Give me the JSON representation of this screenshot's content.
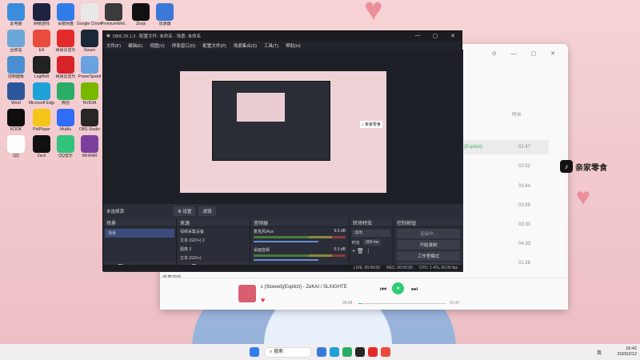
{
  "desktop": {
    "icons": [
      {
        "label": "此电脑",
        "color": "#3a8dde"
      },
      {
        "label": "网络游戏",
        "color": "#1b2340"
      },
      {
        "label": "百度网盘",
        "color": "#2f7dea"
      },
      {
        "label": "Google Chrome",
        "color": "#e8e8e8"
      },
      {
        "label": "PremiumWell...",
        "color": "#3b3b3b"
      },
      {
        "label": "Zbojs",
        "color": "#111111"
      },
      {
        "label": "加速器",
        "color": "#3b78d8"
      },
      {
        "label": "回收站",
        "color": "#6aa7d6"
      },
      {
        "label": "EA",
        "color": "#e94b3c"
      },
      {
        "label": "网易云音乐",
        "color": "#e32b2b"
      },
      {
        "label": "Steam",
        "color": "#1b2838"
      },
      {
        "label": "控制面板",
        "color": "#4a8fd1"
      },
      {
        "label": "LogiBolt",
        "color": "#222222"
      },
      {
        "label": "网易云音乐",
        "color": "#d8232a"
      },
      {
        "label": "PowerSpeed",
        "color": "#6aa1e0"
      },
      {
        "label": "Word",
        "color": "#2b579a"
      },
      {
        "label": "Microsoft Edge",
        "color": "#1fa2d8"
      },
      {
        "label": "微信",
        "color": "#2aae67"
      },
      {
        "label": "NVIDIA",
        "color": "#76b900"
      },
      {
        "label": "KOOK",
        "color": "#0d0d0d"
      },
      {
        "label": "PotPlayer",
        "color": "#f5c518"
      },
      {
        "label": "MuMu",
        "color": "#2f6df6"
      },
      {
        "label": "OBS Studio",
        "color": "#262626"
      },
      {
        "label": "QQ",
        "color": "#ffffff"
      },
      {
        "label": "Zeck",
        "color": "#111111"
      },
      {
        "label": "QQ音乐",
        "color": "#31c27c"
      },
      {
        "label": "WinRAR",
        "color": "#7b3f9e"
      }
    ],
    "wallpaper_text": ""
  },
  "music_app": {
    "right_labels": [
      "时长"
    ],
    "durations": [
      "01:47",
      "03:52",
      "03:44",
      "03:59",
      "03:30",
      "04:33",
      "01:28"
    ],
    "highlight_title": "(Explicit)",
    "bottom_label": "我喜欢听",
    "player": {
      "song": "ε (Slowed)(Explicit) - ZeKAI / SLXIGHTE",
      "elapsed": "00:04",
      "total": "01:47"
    },
    "watermark": "亲家零食"
  },
  "obs": {
    "title": "OBS 29.1.3 - 配置文件: 未命名 - 场景: 未命名",
    "menu": [
      "文件(F)",
      "编辑(E)",
      "视图(V)",
      "停靠窗口(D)",
      "配置文件(P)",
      "场景集合(S)",
      "工具(T)",
      "帮助(H)"
    ],
    "no_source": "未选择源",
    "props_btn": "⚙ 设置",
    "filter_btn": "滤镜",
    "docks": {
      "scenes": {
        "title": "场景",
        "items": [
          "场景"
        ]
      },
      "sources": {
        "title": "来源",
        "items": [
          "视频采集设备",
          "文本 (GDI+) 2",
          "图像 3",
          "文本 (GDI+)",
          "浏览器"
        ]
      },
      "mixer": {
        "title": "音频器",
        "channels": [
          {
            "name": "麦克风/Aux",
            "db": "9.5 dB"
          },
          {
            "name": "桌面音频",
            "db": "0.0 dB"
          }
        ]
      },
      "transitions": {
        "title": "转场特效",
        "type": "淡出",
        "duration_label": "时长",
        "duration": "300 ms"
      },
      "controls": {
        "title": "控制按钮",
        "buttons": [
          "连接中...",
          "开始录制",
          "工作室模式",
          "设置",
          "退出"
        ]
      }
    },
    "status": {
      "live": "LIVE: 00:00:00",
      "rec": "REC: 00:00:00",
      "cpu": "CPU: 1.4%, 60.00 fps"
    }
  },
  "taskbar": {
    "search": "搜索",
    "tray_lang": "英",
    "time": "16:42",
    "date": "2026/2/12"
  }
}
